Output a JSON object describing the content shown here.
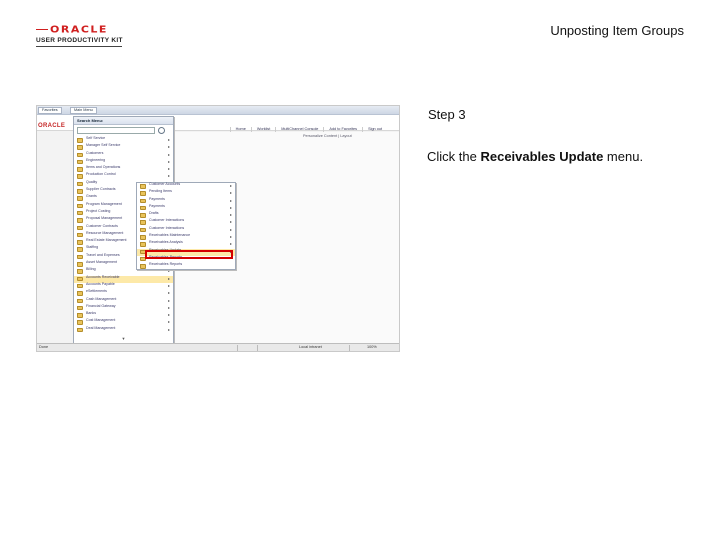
{
  "branding": {
    "logo_oracle": "ORACLE",
    "logo_sub": "USER PRODUCTIVITY KIT"
  },
  "doc_title": "Unposting Item Groups",
  "step": {
    "label": "Step 3",
    "instruction_before": "Click the ",
    "instruction_target": "Receivables Update",
    "instruction_after": " menu."
  },
  "screenshot": {
    "tabs": [
      "Favorites",
      "Main Menu"
    ],
    "brand": "ORACLE",
    "navlinks": [
      "Home",
      "Worklist",
      "MultiChannel Console",
      "Add to Favorites",
      "Sign out"
    ],
    "favorites_label": "Personalize Content | Layout",
    "menu_title": "Search Menu:",
    "main_menu_items": [
      {
        "label": "Self Service",
        "arrow": true
      },
      {
        "label": "Manager Self Service",
        "arrow": true
      },
      {
        "label": "Customers",
        "arrow": true
      },
      {
        "label": "Engineering",
        "arrow": true
      },
      {
        "label": "Items and Operations",
        "arrow": true
      },
      {
        "label": "Production Control",
        "arrow": true
      },
      {
        "label": "Quality",
        "arrow": false
      },
      {
        "label": "Supplier Contracts",
        "arrow": true
      },
      {
        "label": "Grants",
        "arrow": true
      },
      {
        "label": "Program Management",
        "arrow": true
      },
      {
        "label": "Project Costing",
        "arrow": true
      },
      {
        "label": "Proposal Management",
        "arrow": true
      },
      {
        "label": "Customer Contracts",
        "arrow": true
      },
      {
        "label": "Resource Management",
        "arrow": true
      },
      {
        "label": "Real Estate Management",
        "arrow": true
      },
      {
        "label": "Staffing",
        "arrow": true
      },
      {
        "label": "Travel and Expenses",
        "arrow": true
      },
      {
        "label": "Asset Management",
        "arrow": true
      },
      {
        "label": "Billing",
        "arrow": true
      },
      {
        "label": "Accounts Receivable",
        "arrow": true,
        "highlight": true
      },
      {
        "label": "Accounts Payable",
        "arrow": true
      },
      {
        "label": "eSettlements",
        "arrow": true
      },
      {
        "label": "Cash Management",
        "arrow": true
      },
      {
        "label": "Financial Gateway",
        "arrow": true
      },
      {
        "label": "Banks",
        "arrow": true
      },
      {
        "label": "Cost Management",
        "arrow": true
      },
      {
        "label": "Deal Management",
        "arrow": true
      }
    ],
    "submenu_items": [
      {
        "label": "Customer Accounts",
        "arrow": true
      },
      {
        "label": "Pending Items",
        "arrow": true
      },
      {
        "label": "Payments",
        "arrow": true
      },
      {
        "label": "Payments",
        "arrow": true
      },
      {
        "label": "Drafts",
        "arrow": true
      },
      {
        "label": "Customer Interactions",
        "arrow": true
      },
      {
        "label": "Customer Interactions",
        "arrow": true
      },
      {
        "label": "Receivables Maintenance",
        "arrow": true
      },
      {
        "label": "Receivables Analysis",
        "arrow": true
      },
      {
        "label": "Receivables Update",
        "arrow": true,
        "selected": true
      },
      {
        "label": "Receivables Reports",
        "arrow": false
      },
      {
        "label": "Receivables Reports",
        "arrow": false
      }
    ],
    "status": {
      "left": "Done",
      "zone": "Local intranet",
      "zoom": "100%"
    }
  },
  "colors": {
    "brand_red": "#d01f1f",
    "highlight_box": "#d40000",
    "menu_highlight": "#fde9a8"
  }
}
